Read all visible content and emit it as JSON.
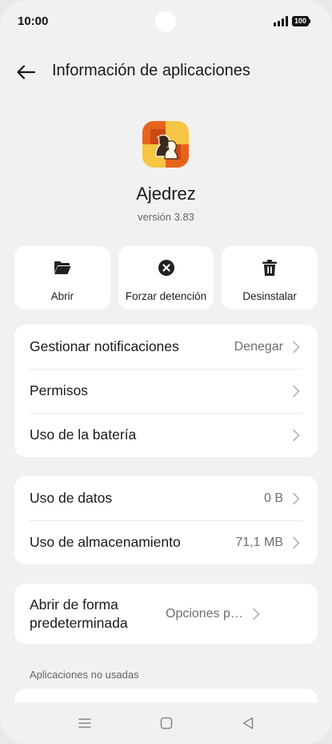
{
  "status_bar": {
    "time": "10:00",
    "battery": "100"
  },
  "header": {
    "title": "Información de aplicaciones",
    "back_icon": "arrow-left-icon"
  },
  "app": {
    "name": "Ajedrez",
    "version": "versión 3.83",
    "icon": "chess-knight-app-icon"
  },
  "actions": [
    {
      "label": "Abrir",
      "icon": "folder-open-icon"
    },
    {
      "label": "Forzar detención",
      "icon": "stop-circle-icon"
    },
    {
      "label": "Desinstalar",
      "icon": "trash-icon"
    }
  ],
  "group1": [
    {
      "label": "Gestionar notificaciones",
      "value": "Denegar"
    },
    {
      "label": "Permisos",
      "value": ""
    },
    {
      "label": "Uso de la batería",
      "value": ""
    }
  ],
  "group2": [
    {
      "label": "Uso de datos",
      "value": "0 B"
    },
    {
      "label": "Uso de almacenamiento",
      "value": "71,1 MB"
    }
  ],
  "group3": [
    {
      "label": "Abrir de forma predeterminada",
      "value": "Opciones p…"
    }
  ],
  "section_unused": "Aplicaciones no usadas",
  "colors": {
    "background": "#f1f1f1",
    "card": "#ffffff",
    "icon_orange": "#e8641b",
    "icon_yellow": "#f6c544"
  }
}
